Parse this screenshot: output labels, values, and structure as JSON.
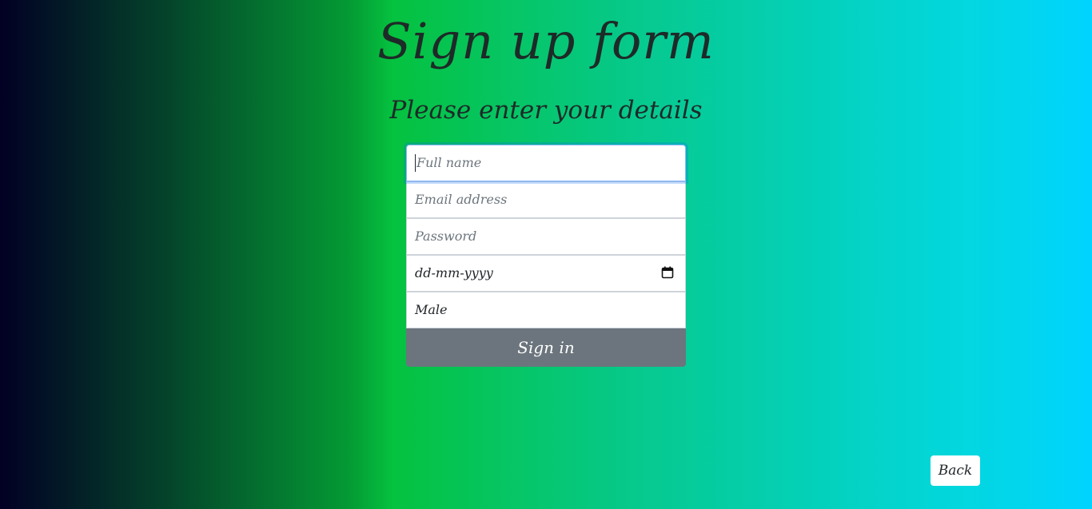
{
  "page": {
    "title": "Sign up form",
    "subtitle": "Please enter your details"
  },
  "form": {
    "full_name": {
      "placeholder": "Full name",
      "value": ""
    },
    "email": {
      "placeholder": "Email address",
      "value": ""
    },
    "password": {
      "placeholder": "Password",
      "value": ""
    },
    "date": {
      "value": "dd-mm-yyyy",
      "icon": "calendar-icon"
    },
    "gender": {
      "value": "Male"
    },
    "submit_label": "Sign in"
  },
  "back_label": "Back",
  "colors": {
    "gradient_start": "#020024",
    "gradient_mid": "#05c23f",
    "gradient_end": "#00d4ff",
    "submit_bg": "#6c757d",
    "text_dark": "#1e2a28"
  }
}
